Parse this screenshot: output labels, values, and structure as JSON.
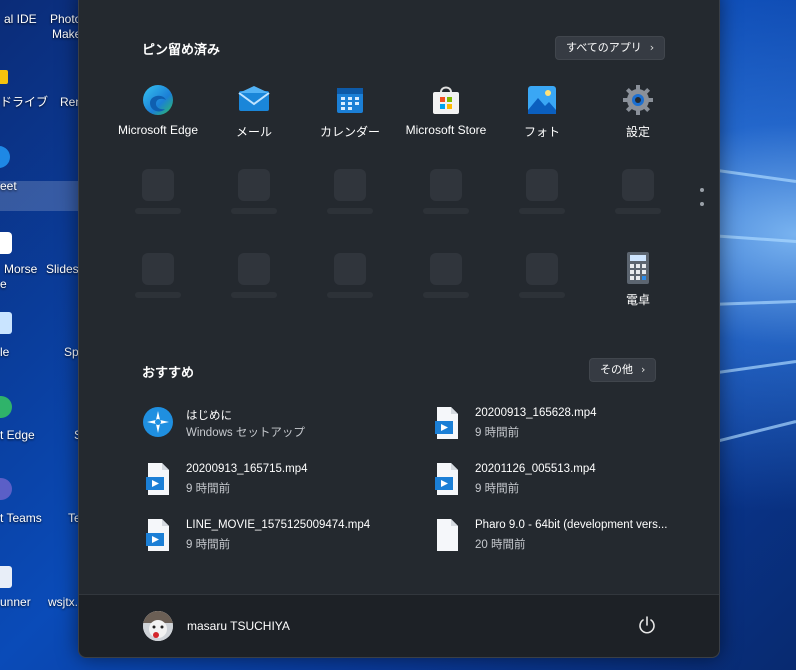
{
  "desktop": {
    "icons": [
      {
        "label": "al IDE"
      },
      {
        "label": "Photo"
      },
      {
        "label": "Make"
      },
      {
        "label": "ドライブ"
      },
      {
        "label": "Ren"
      },
      {
        "label": "eet"
      },
      {
        "label": "Morse"
      },
      {
        "label": "e"
      },
      {
        "label": "Slides"
      },
      {
        "label": "le"
      },
      {
        "label": "Sp"
      },
      {
        "label": "t Edge"
      },
      {
        "label": "S"
      },
      {
        "label": "t Teams"
      },
      {
        "label": "Te"
      },
      {
        "label": "unner"
      },
      {
        "label": "wsjtx."
      }
    ]
  },
  "start_menu": {
    "pinned": {
      "title": "ピン留め済み",
      "all_apps_label": "すべてのアプリ",
      "apps": [
        {
          "label": "Microsoft Edge",
          "icon": "edge-icon"
        },
        {
          "label": "メール",
          "icon": "mail-icon"
        },
        {
          "label": "カレンダー",
          "icon": "calendar-icon"
        },
        {
          "label": "Microsoft Store",
          "icon": "store-icon"
        },
        {
          "label": "フォト",
          "icon": "photos-icon"
        },
        {
          "label": "設定",
          "icon": "settings-gear-icon"
        },
        {
          "label": "電卓",
          "icon": "calculator-icon"
        }
      ]
    },
    "recommended": {
      "title": "おすすめ",
      "more_label": "その他",
      "items": [
        {
          "name": "はじめに",
          "detail": "Windows セットアップ",
          "icon": "get-started-icon"
        },
        {
          "name": "20200913_165628.mp4",
          "detail": "9 時間前",
          "icon": "video-file-icon"
        },
        {
          "name": "20200913_165715.mp4",
          "detail": "9 時間前",
          "icon": "video-file-icon"
        },
        {
          "name": "20201126_005513.mp4",
          "detail": "9 時間前",
          "icon": "video-file-icon"
        },
        {
          "name": "LINE_MOVIE_1575125009474.mp4",
          "detail": "9 時間前",
          "icon": "video-file-icon"
        },
        {
          "name": "Pharo 9.0 - 64bit (development vers...",
          "detail": "20 時間前",
          "icon": "blank-file-icon"
        }
      ]
    },
    "user": {
      "name": "masaru TSUCHIYA"
    },
    "power_icon": "power-icon"
  }
}
